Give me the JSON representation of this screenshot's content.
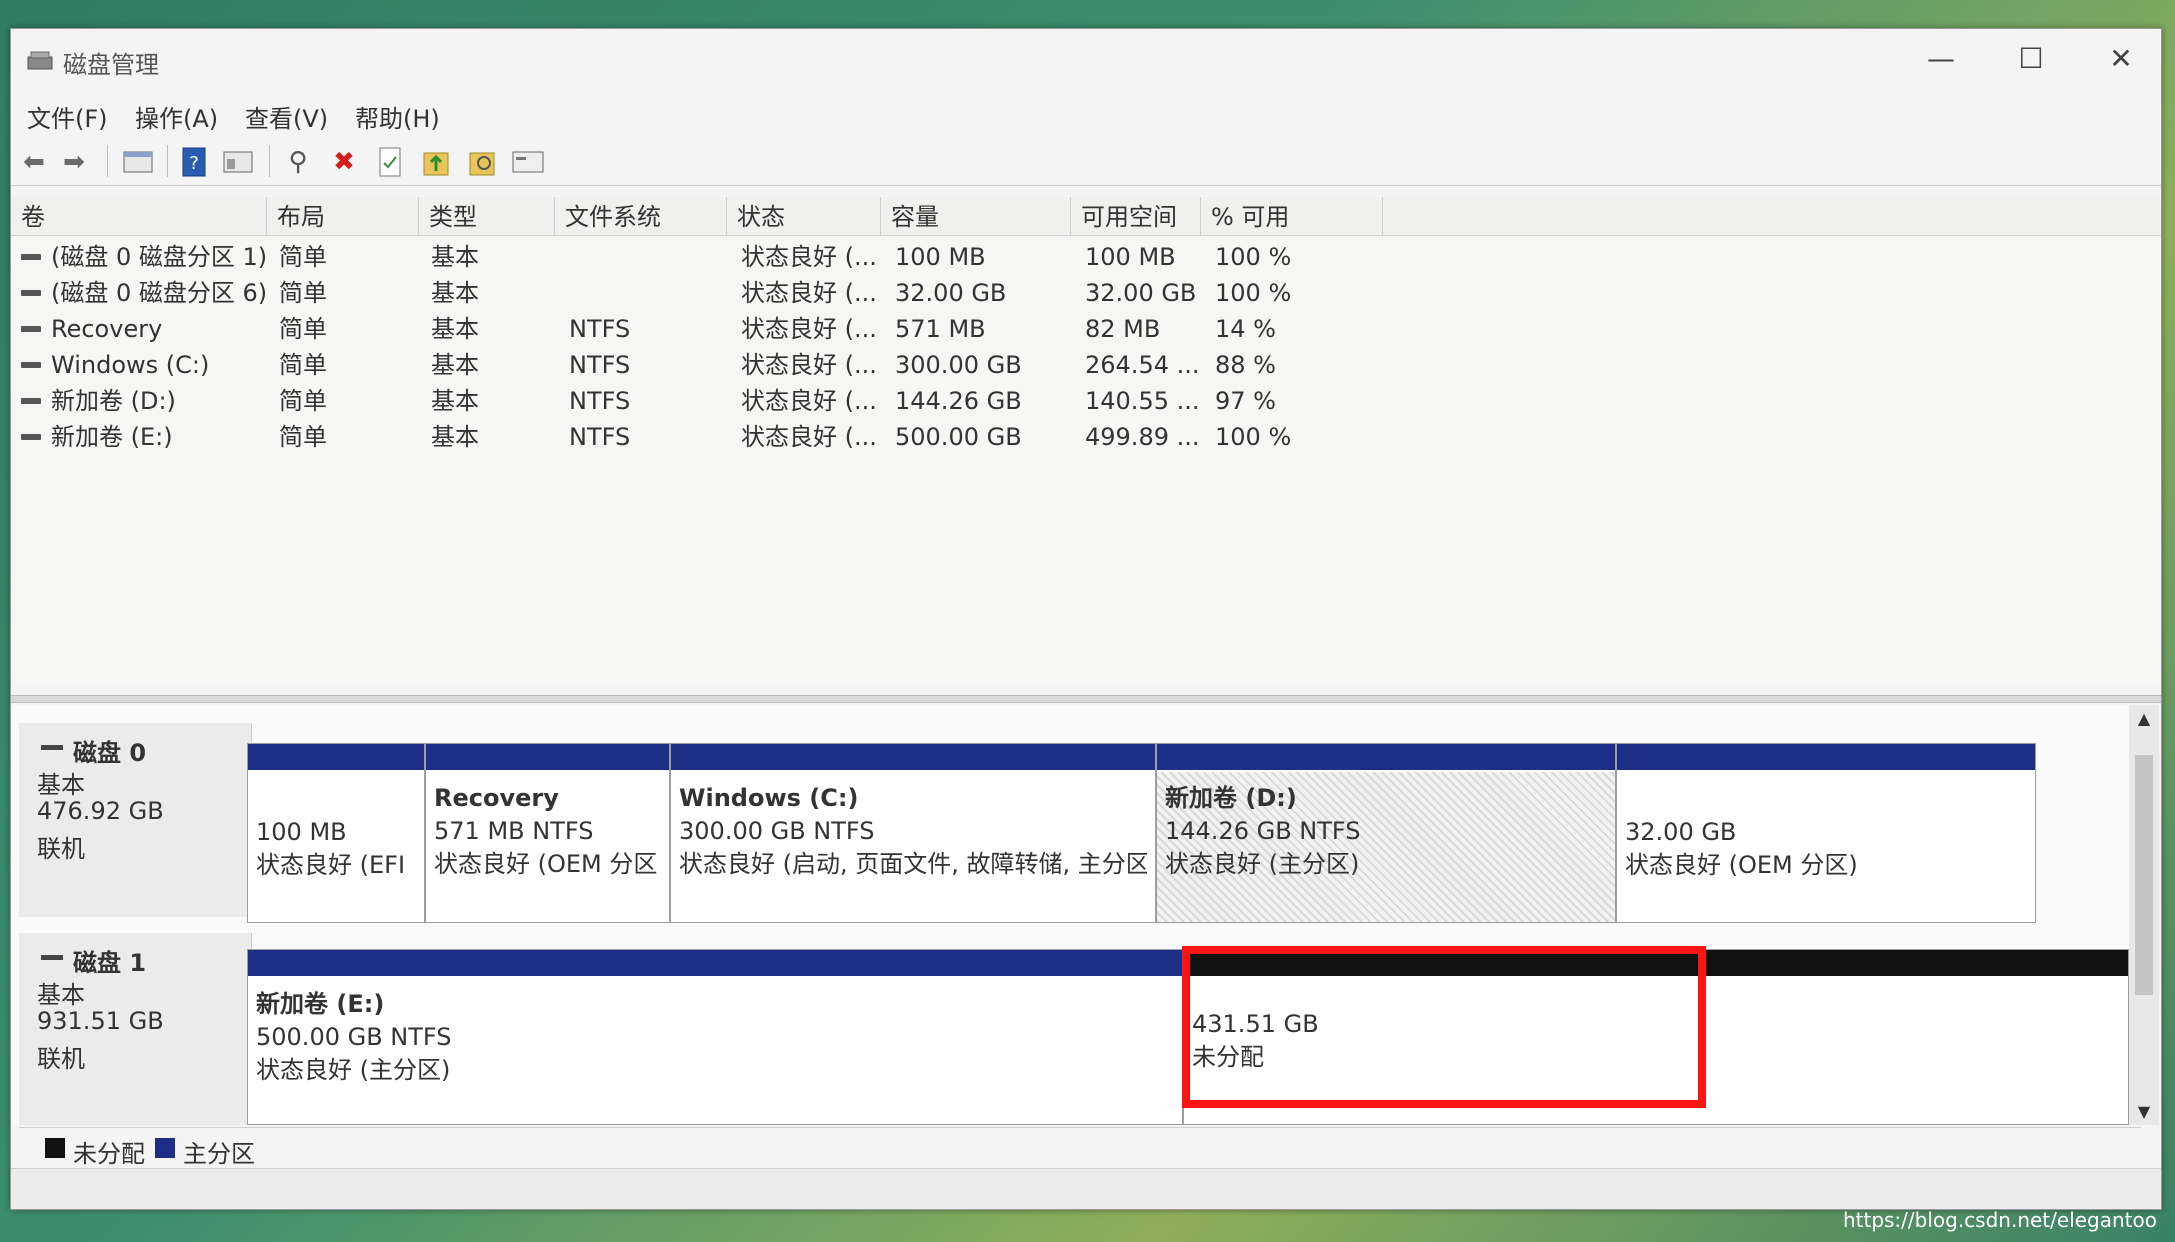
{
  "window": {
    "title": "磁盘管理",
    "menu": [
      "文件(F)",
      "操作(A)",
      "查看(V)",
      "帮助(H)"
    ]
  },
  "toolbar_icons": [
    "back-arrow-icon",
    "forward-arrow-icon",
    "console-tree-icon",
    "help-icon",
    "properties-icon",
    "connect-icon",
    "delete-icon",
    "refresh-icon",
    "export-icon",
    "rescan-icon",
    "view-icon"
  ],
  "volume_table": {
    "columns": [
      "卷",
      "布局",
      "类型",
      "文件系统",
      "状态",
      "容量",
      "可用空间",
      "% 可用"
    ],
    "rows": [
      [
        "(磁盘 0 磁盘分区 1)",
        "简单",
        "基本",
        "",
        "状态良好 (...",
        "100 MB",
        "100 MB",
        "100 %"
      ],
      [
        "(磁盘 0 磁盘分区 6)",
        "简单",
        "基本",
        "",
        "状态良好 (...",
        "32.00 GB",
        "32.00 GB",
        "100 %"
      ],
      [
        "Recovery",
        "简单",
        "基本",
        "NTFS",
        "状态良好 (...",
        "571 MB",
        "82 MB",
        "14 %"
      ],
      [
        "Windows (C:)",
        "简单",
        "基本",
        "NTFS",
        "状态良好 (...",
        "300.00 GB",
        "264.54 ...",
        "88 %"
      ],
      [
        "新加卷 (D:)",
        "简单",
        "基本",
        "NTFS",
        "状态良好 (...",
        "144.26 GB",
        "140.55 ...",
        "97 %"
      ],
      [
        "新加卷 (E:)",
        "简单",
        "基本",
        "NTFS",
        "状态良好 (...",
        "500.00 GB",
        "499.89 ...",
        "100 %"
      ]
    ]
  },
  "disk0": {
    "name": "磁盘 0",
    "type": "基本",
    "size": "476.92 GB",
    "status": "联机",
    "partitions": [
      {
        "title": "",
        "line1": "100 MB",
        "line2": "状态良好 (EFI"
      },
      {
        "title": "Recovery",
        "line1": "571 MB NTFS",
        "line2": "状态良好 (OEM 分区"
      },
      {
        "title": "Windows  (C:)",
        "line1": "300.00 GB NTFS",
        "line2": "状态良好 (启动, 页面文件, 故障转储, 主分区"
      },
      {
        "title": "新加卷  (D:)",
        "line1": "144.26 GB NTFS",
        "line2": "状态良好 (主分区)"
      },
      {
        "title": "",
        "line1": "32.00 GB",
        "line2": "状态良好 (OEM 分区)"
      }
    ]
  },
  "disk1": {
    "name": "磁盘 1",
    "type": "基本",
    "size": "931.51 GB",
    "status": "联机",
    "partitions": [
      {
        "title": "新加卷  (E:)",
        "line1": "500.00 GB NTFS",
        "line2": "状态良好 (主分区)"
      },
      {
        "title": "",
        "line1": "431.51 GB",
        "line2": "未分配"
      }
    ]
  },
  "legend": [
    {
      "label": "未分配",
      "color": "#111111"
    },
    {
      "label": "主分区",
      "color": "#1c2e85"
    }
  ],
  "watermark": "https://blog.csdn.net/elegantoo"
}
